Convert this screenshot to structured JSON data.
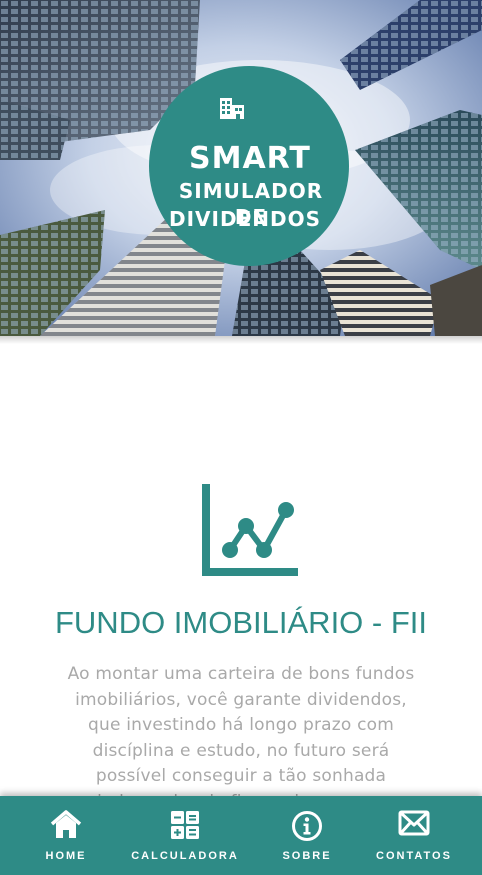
{
  "hero": {
    "brand": "SMART",
    "subtitle_line1": "SIMULADOR DE",
    "subtitle_line2": "DIVIDENDOS",
    "icon": "building-icon"
  },
  "section": {
    "icon": "line-chart-icon",
    "title": "FUNDO IMOBILIÁRIO - FII",
    "text": "Ao montar uma carteira de bons fundos imobiliários, você garante dividendos, que investindo há longo prazo com discíplina e estudo, no futuro será possível conseguir a tão sonhada independencia financeira com os dividendos recebidos mensalmente sem precisar"
  },
  "nav": {
    "items": [
      {
        "label": "HOME",
        "icon": "home-icon"
      },
      {
        "label": "CALCULADORA",
        "icon": "calculator-icon"
      },
      {
        "label": "SOBRE",
        "icon": "info-icon"
      },
      {
        "label": "CONTATOS",
        "icon": "envelope-icon"
      }
    ]
  },
  "colors": {
    "accent": "#2e8b86",
    "text_muted": "#a9a9a9",
    "background": "#ffffff"
  }
}
